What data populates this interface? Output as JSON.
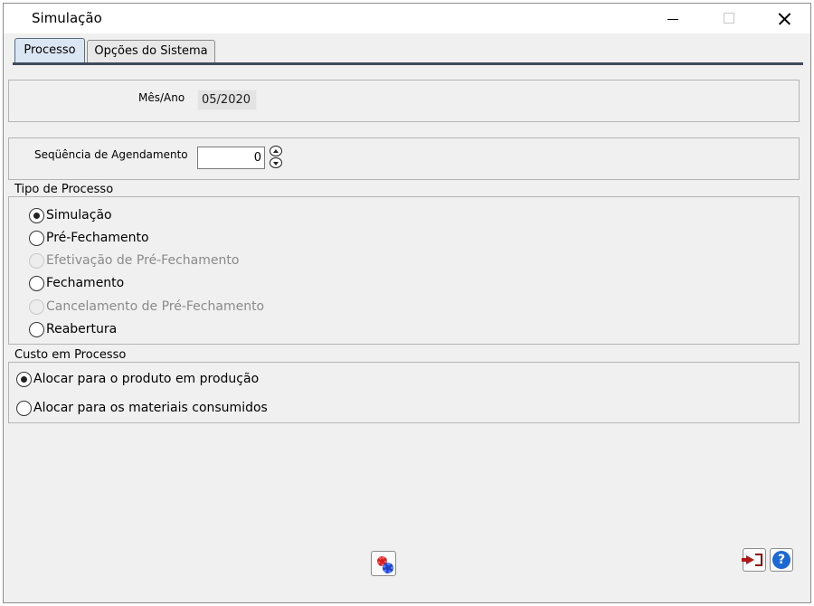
{
  "window": {
    "title": "Simulação",
    "controls": {
      "minimize": "minimize-icon",
      "maximize": "maximize-icon",
      "close": "close-icon"
    }
  },
  "tabs": [
    {
      "label": "Processo",
      "active": true
    },
    {
      "label": "Opções do Sistema",
      "active": false
    }
  ],
  "mes_ano": {
    "label": "Mês/Ano",
    "value": "05/2020"
  },
  "sequencia": {
    "label": "Seqüência de Agendamento",
    "value": "0"
  },
  "tipo_processo": {
    "title": "Tipo de Processo",
    "options": [
      {
        "label": "Simulação",
        "checked": true,
        "enabled": true
      },
      {
        "label": "Pré-Fechamento",
        "checked": false,
        "enabled": true
      },
      {
        "label": "Efetivação de Pré-Fechamento",
        "checked": false,
        "enabled": false
      },
      {
        "label": "Fechamento",
        "checked": false,
        "enabled": true
      },
      {
        "label": "Cancelamento de Pré-Fechamento",
        "checked": false,
        "enabled": false
      },
      {
        "label": "Reabertura",
        "checked": false,
        "enabled": true
      }
    ]
  },
  "custo_processo": {
    "title": "Custo em Processo",
    "options": [
      {
        "label": "Alocar para o produto em produção",
        "checked": true,
        "enabled": true
      },
      {
        "label": "Alocar para os materiais consumidos",
        "checked": false,
        "enabled": true
      }
    ]
  },
  "buttons": {
    "process": "gears-icon",
    "exit": "exit-icon",
    "help": "help-icon"
  },
  "colors": {
    "tab_active": "#dbe6f4",
    "tab_line": "#3c4a5c",
    "help_blue": "#1c68d4",
    "exit_red": "#b01818"
  }
}
